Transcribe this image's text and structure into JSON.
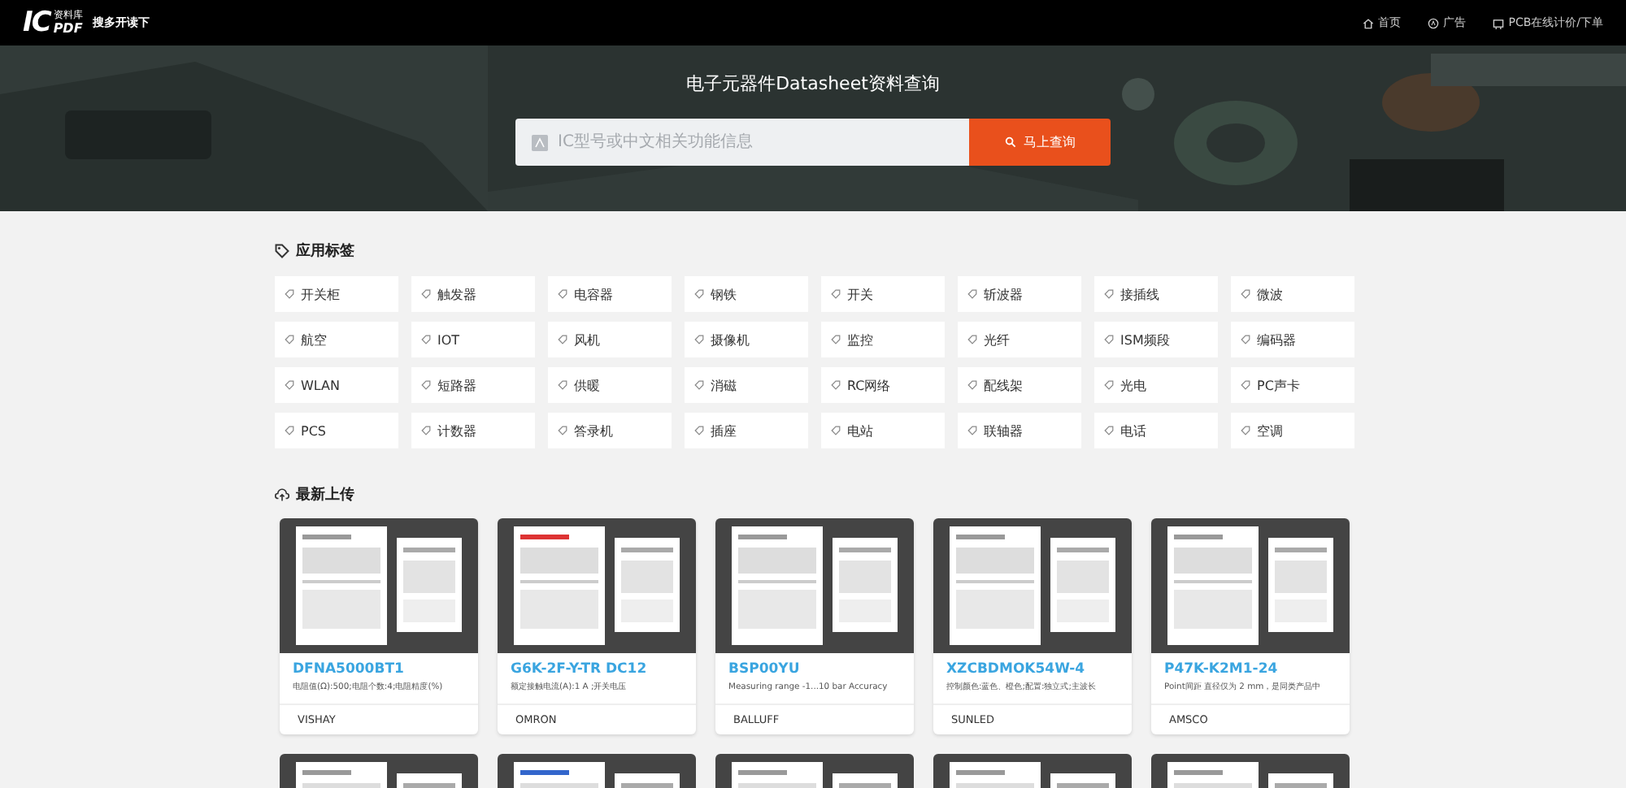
{
  "header": {
    "logo": {
      "big": "IC",
      "small_top": "资料库",
      "small_bottom": "PDF"
    },
    "slogan": "搜多开读下",
    "nav": [
      {
        "label": "首页"
      },
      {
        "label": "广告"
      },
      {
        "label": "PCB在线计价/下单"
      }
    ]
  },
  "hero": {
    "title": "电子元器件Datasheet资料查询",
    "search": {
      "placeholder": "IC型号或中文相关功能信息"
    },
    "button": "马上查询"
  },
  "tags_section": {
    "title": "应用标签",
    "tags": [
      "开关柜",
      "触发器",
      "电容器",
      "钢铁",
      "开关",
      "斩波器",
      "接插线",
      "微波",
      "航空",
      "IOT",
      "风机",
      "摄像机",
      "监控",
      "光纤",
      "ISM频段",
      "编码器",
      "WLAN",
      "短路器",
      "供暖",
      "消磁",
      "RC网络",
      "配线架",
      "光电",
      "PC声卡",
      "PCS",
      "计数器",
      "答录机",
      "插座",
      "电站",
      "联轴器",
      "电话",
      "空调"
    ]
  },
  "uploads_section": {
    "title": "最新上传",
    "cards": [
      {
        "title": "DFNA5000BT1",
        "description": "电阻值(Ω):500;电阻个数:4;电阻精度(%)",
        "maker": "VISHAY"
      },
      {
        "title": "G6K-2F-Y-TR DC12",
        "description": "额定接触电流(A):1 A ;开关电压",
        "maker": "OMRON"
      },
      {
        "title": "BSP00YU",
        "description": "Measuring range -1...10 bar Accuracy",
        "maker": "BALLUFF"
      },
      {
        "title": "XZCBDMOK54W-4",
        "description": "控制颜色:蓝色、橙色;配置:独立式;主波长",
        "maker": "SUNLED"
      },
      {
        "title": "P47K-K2M1-24",
        "description": "Point间距 直径仅为 2 mm，是同类产品中",
        "maker": "AMSCO"
      }
    ]
  }
}
